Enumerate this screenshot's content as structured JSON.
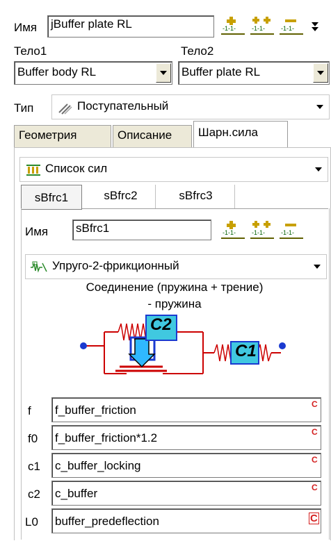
{
  "header": {
    "name_label": "Имя",
    "name_value": "jBuffer plate RL",
    "body1_label": "Тело1",
    "body2_label": "Тело2",
    "body1_value": "Buffer body RL",
    "body2_value": "Buffer plate RL",
    "type_label": "Тип",
    "type_value": "Поступательный"
  },
  "tabs": [
    {
      "label": "Геометрия"
    },
    {
      "label": "Описание"
    },
    {
      "label": "Шарн.сила"
    }
  ],
  "forces": {
    "list_label": "Список сил",
    "subtabs": [
      {
        "label": "sBfrc1"
      },
      {
        "label": "sBfrc2"
      },
      {
        "label": "sBfrc3"
      }
    ],
    "name_label": "Имя",
    "name_value": "sBfrc1",
    "model_value": "Упруго-2-фрикционный",
    "connection_title_line1": "Соединение (пружина + трение)",
    "connection_title_line2": "- пружина",
    "diagram": {
      "c2_label": "C2",
      "c1_label": "C1"
    }
  },
  "params": [
    {
      "label": "f",
      "value": "f_buffer_friction",
      "mark": "C"
    },
    {
      "label": "f0",
      "value": "f_buffer_friction*1.2",
      "mark": "C"
    },
    {
      "label": "c1",
      "value": "c_buffer_locking",
      "mark": "C"
    },
    {
      "label": "c2",
      "value": "c_buffer",
      "mark": "C"
    },
    {
      "label": "L0",
      "value": "buffer_predeflection",
      "mark": "C"
    }
  ]
}
